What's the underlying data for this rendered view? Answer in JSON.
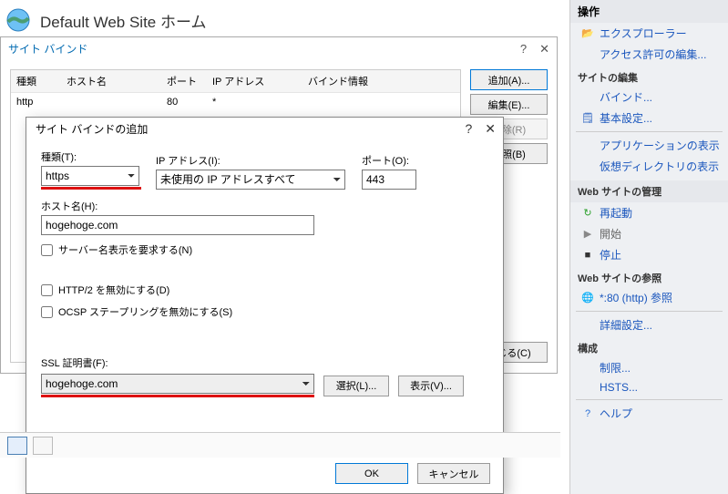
{
  "page": {
    "title": "Default Web Site ホーム"
  },
  "bindings_dialog": {
    "title": "サイト バインド",
    "help_glyph": "?",
    "close_glyph": "✕",
    "columns": {
      "type": "種類",
      "host": "ホスト名",
      "port": "ポート",
      "ip": "IP アドレス",
      "info": "バインド情報"
    },
    "rows": [
      {
        "type": "http",
        "host": "",
        "port": "80",
        "ip": "*",
        "info": ""
      }
    ],
    "buttons": {
      "add": "追加(A)...",
      "edit": "編集(E)...",
      "remove": "削除(R)",
      "browse": "参照(B)",
      "close": "閉じる(C)"
    }
  },
  "add_dialog": {
    "title": "サイト バインドの追加",
    "help_glyph": "?",
    "close_glyph": "✕",
    "labels": {
      "type": "種類(T):",
      "ip": "IP アドレス(I):",
      "port": "ポート(O):",
      "host": "ホスト名(H):",
      "sni": "サーバー名表示を要求する(N)",
      "http2": "HTTP/2 を無効にする(D)",
      "ocsp": "OCSP ステープリングを無効にする(S)",
      "ssl": "SSL 証明書(F):"
    },
    "values": {
      "type": "https",
      "ip": "未使用の IP アドレスすべて",
      "port": "443",
      "host": "hogehoge.com",
      "ssl": "hogehoge.com"
    },
    "buttons": {
      "select": "選択(L)...",
      "view": "表示(V)...",
      "ok": "OK",
      "cancel": "キャンセル"
    }
  },
  "actions": {
    "pane_title": "操作",
    "explore": "エクスプローラー",
    "edit_permissions": "アクセス許可の編集...",
    "group_edit_site": "サイトの編集",
    "bindings": "バインド...",
    "basic_settings": "基本設定...",
    "view_apps": "アプリケーションの表示",
    "view_vdirs": "仮想ディレクトリの表示",
    "group_manage_website": "Web サイトの管理",
    "restart": "再起動",
    "start": "開始",
    "stop": "停止",
    "group_browse": "Web サイトの参照",
    "browse80": "*:80 (http) 参照",
    "advanced": "詳細設定...",
    "group_config": "構成",
    "limits": "制限...",
    "hsts": "HSTS...",
    "help": "ヘルプ"
  }
}
